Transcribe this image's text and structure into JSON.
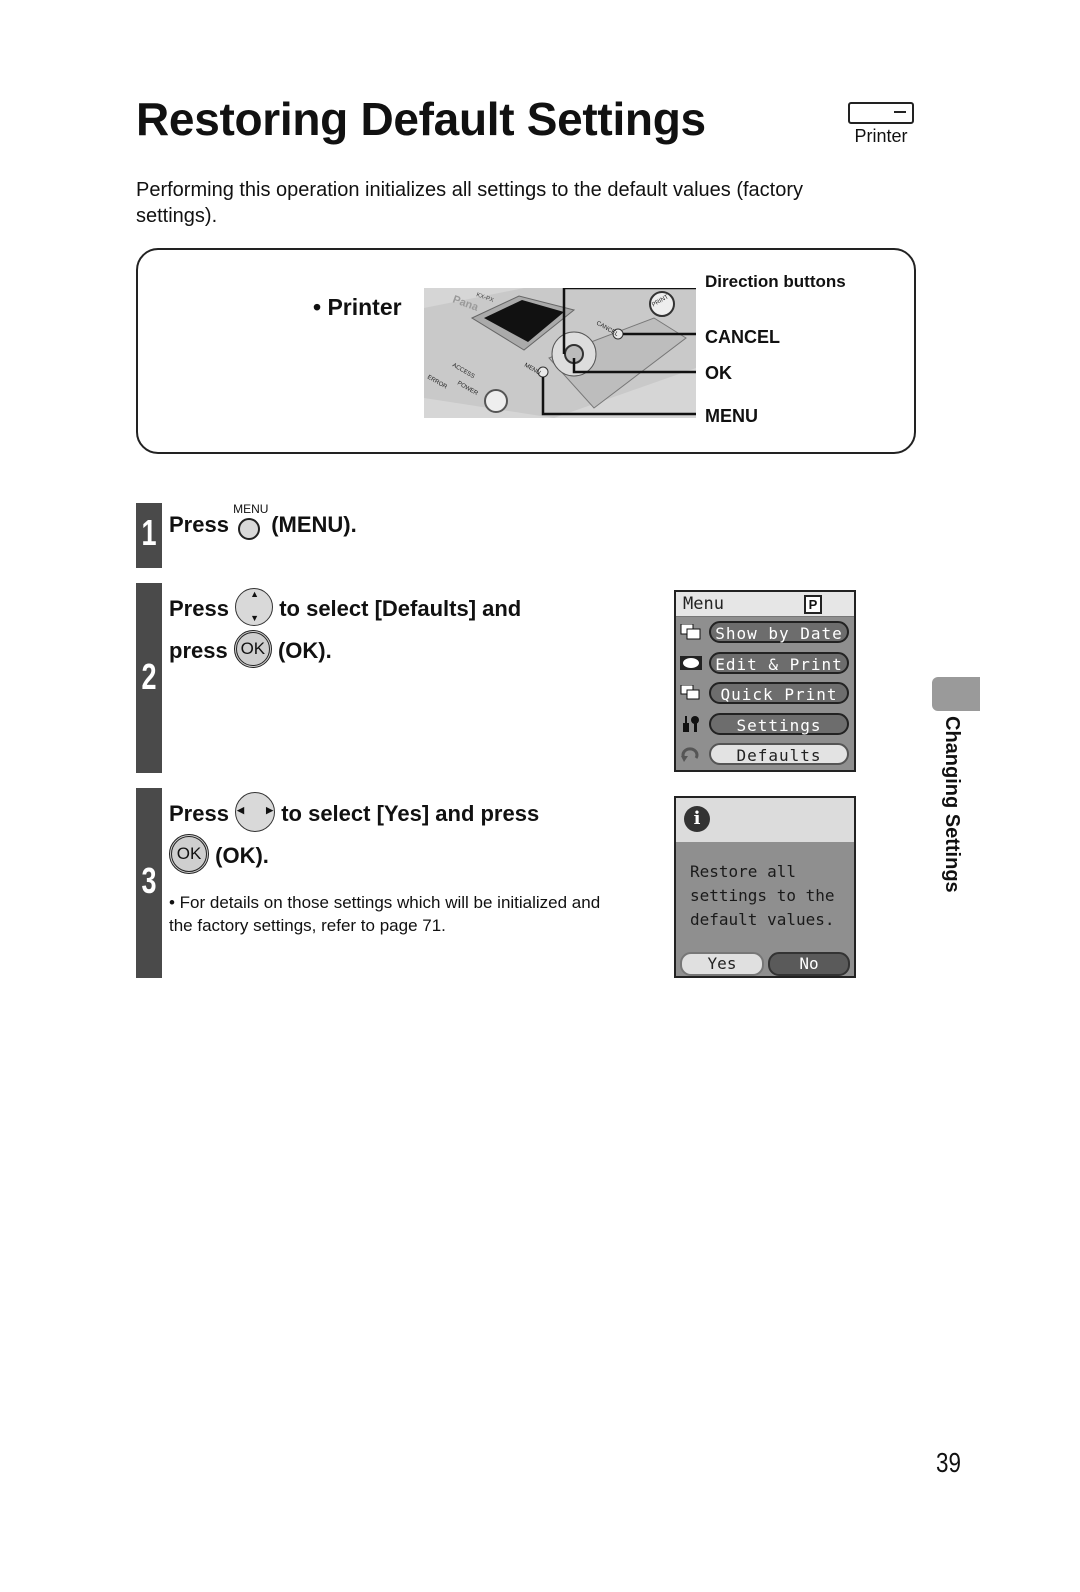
{
  "header": {
    "title": "Restoring Default Settings",
    "device_badge": {
      "icon": "printer-icon",
      "label": "Printer"
    }
  },
  "intro": "Performing this operation initializes all settings to the default values (factory settings).",
  "printer_panel": {
    "label": "• Printer",
    "callouts": [
      "Direction buttons",
      "CANCEL",
      "OK",
      "MENU"
    ],
    "illustration_labels": {
      "brand": "Pana",
      "model": "KX-PX",
      "print": "PRINT",
      "cancel": "CANCEL",
      "menu": "MENU",
      "error": "ERROR",
      "access": "ACCESS",
      "power": "POWER"
    }
  },
  "steps": [
    {
      "number": "1",
      "line1": {
        "prefix": "Press",
        "icon": "menu-button-icon",
        "icon_caption": "MENU",
        "suffix": "(MENU)."
      }
    },
    {
      "number": "2",
      "line1": {
        "prefix": "Press",
        "icon": "up-down-button-icon",
        "suffix": "to select [Defaults] and"
      },
      "line2": {
        "prefix": "press",
        "icon": "ok-button-icon",
        "icon_caption": "OK",
        "suffix": "(OK)."
      }
    },
    {
      "number": "3",
      "line1": {
        "prefix": "Press",
        "icon": "left-right-button-icon",
        "suffix": "to select [Yes] and press"
      },
      "line2": {
        "icon": "ok-button-icon",
        "icon_caption": "OK",
        "suffix": "(OK)."
      },
      "note": "• For details on those settings which will be initialized and the factory settings, refer to page 71."
    }
  ],
  "menu_screen": {
    "title": "Menu",
    "badge": "P",
    "items": [
      {
        "icon": "show-by-date-icon",
        "label": "Show by Date",
        "selected": false
      },
      {
        "icon": "edit-print-icon",
        "label": "Edit & Print",
        "selected": false
      },
      {
        "icon": "quick-print-icon",
        "label": "Quick Print",
        "selected": false
      },
      {
        "icon": "settings-tools-icon",
        "label": "Settings",
        "selected": false
      },
      {
        "icon": "defaults-icon",
        "label": "Defaults",
        "selected": true
      }
    ]
  },
  "confirm_screen": {
    "icon": "info-icon",
    "info_glyph": "i",
    "message": "Restore all\nsettings to the\ndefault values.",
    "yes_label": "Yes",
    "no_label": "No",
    "selected": "No"
  },
  "side_tab": {
    "label": "Changing Settings",
    "color": "#9a9a9a"
  },
  "page_number": "39"
}
